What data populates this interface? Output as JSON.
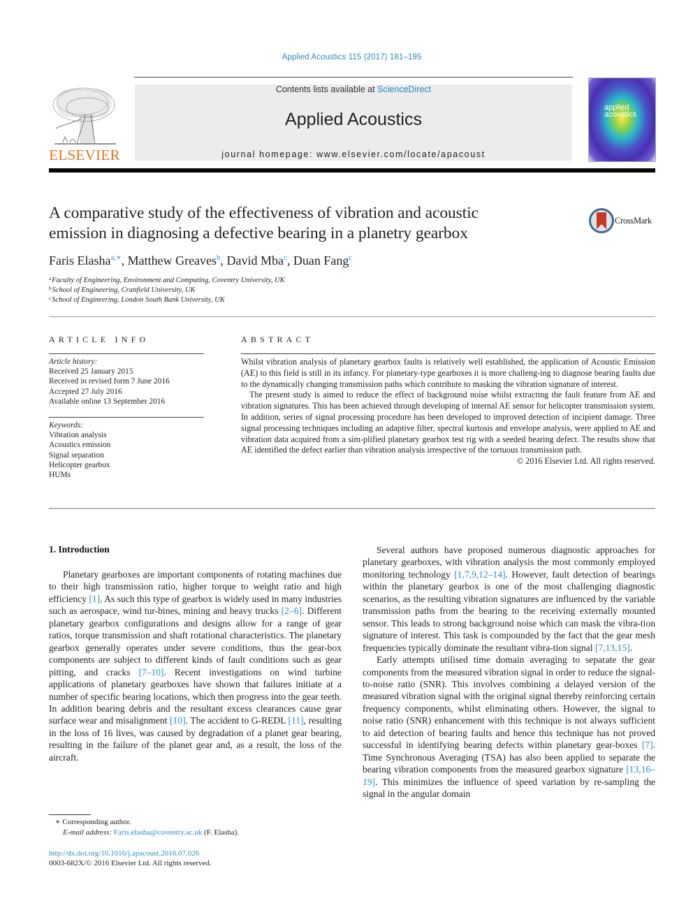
{
  "header": {
    "journal_ref": "Applied Acoustics 115 (2017) 181–195",
    "contents_prefix": "Contents lists available at ",
    "sciencedirect_link": "ScienceDirect",
    "journal_name": "Applied Acoustics",
    "homepage_prefix": "journal homepage: ",
    "homepage_url": "www.elsevier.com/locate/apacoust",
    "publisher_logo_text": "ELSEVIER",
    "cover_title_line1": "applied",
    "cover_title_line2": "acoustics",
    "colors": {
      "link": "#2a8bbf",
      "elsevier_orange": "#e9711c",
      "banner_bg": "#ececec"
    }
  },
  "article": {
    "title_line1": "A comparative study of the effectiveness of vibration and acoustic",
    "title_line2": "emission in diagnosing a defective bearing in a planetry gearbox",
    "crossmark_label": "CrossMark",
    "authors": [
      {
        "name": "Faris Elasha",
        "sup": "a,∗"
      },
      {
        "name": "Matthew Greaves",
        "sup": "b"
      },
      {
        "name": "David Mba",
        "sup": "c"
      },
      {
        "name": "Duan Fang",
        "sup": "c"
      }
    ],
    "affiliations": [
      {
        "key": "a",
        "text": "Faculty of Engineering, Environment and Computing, Coventry University, UK"
      },
      {
        "key": "b",
        "text": "School of Engineering, Cranfield University, UK"
      },
      {
        "key": "c",
        "text": "School of Engineering, London South Bank University, UK"
      }
    ]
  },
  "article_info": {
    "heading": "ARTICLE INFO",
    "history_label": "Article history:",
    "history": [
      "Received 25 January 2015",
      "Received in revised form 7 June 2016",
      "Accepted 27 July 2016",
      "Available online 13 September 2016"
    ],
    "keywords_label": "Keywords:",
    "keywords": [
      "Vibration analysis",
      "Acoustics emission",
      "Signal separation",
      "Helicopter gearbox",
      "HUMs"
    ]
  },
  "abstract": {
    "heading": "ABSTRACT",
    "paragraphs": [
      "Whilst vibration analysis of planetary gearbox faults is relatively well established, the application of Acoustic Emission (AE) to this field is still in its infancy. For planetary-type gearboxes it is more challeng-ing to diagnose bearing faults due to the dynamically changing transmission paths which contribute to masking the vibration signature of interest.",
      "The present study is aimed to reduce the effect of background noise whilst extracting the fault feature from AE and vibration signatures. This has been achieved through developing of internal AE sensor for helicopter transmission system. In addition, series of signal processing procedure has been developed to improved detection of incipient damage. Three signal processing techniques including an adaptive filter, spectral kurtosis and envelope analysis, were applied to AE and vibration data acquired from a sim-plified planetary gearbox test rig with a seeded bearing defect. The results show that AE identified the defect earlier than vibration analysis irrespective of the tortuous transmission path."
    ],
    "copyright": "© 2016 Elsevier Ltd. All rights reserved."
  },
  "body": {
    "section_heading": "1. Introduction",
    "left_paragraph": [
      {
        "t": "Planetary gearboxes are important components of rotating machines due to their high transmission ratio, higher torque to weight ratio and high efficiency "
      },
      {
        "ref": "[1]"
      },
      {
        "t": ". As such this type of gearbox is widely used in many industries such as aerospace, wind tur-bines, mining and heavy trucks "
      },
      {
        "ref": "[2–6]"
      },
      {
        "t": ". Different planetary gearbox configurations and designs allow for a range of gear ratios, torque transmission and shaft rotational characteristics. The planetary gearbox generally operates under severe conditions, thus the gear-box components are subject to different kinds of fault conditions such as gear pitting, and cracks "
      },
      {
        "ref": "[7–10]"
      },
      {
        "t": ". Recent investigations on wind turbine applications of planetary gearboxes have shown that failures initiate at a number of specific bearing locations, which then progress into the gear teeth. In addition bearing debris and the resultant excess clearances cause gear surface wear and misalignment "
      },
      {
        "ref": "[10]"
      },
      {
        "t": ". The accident to G-REDL "
      },
      {
        "ref": "[11]"
      },
      {
        "t": ", resulting in the loss of 16 lives, was caused by degradation of a planet gear bearing, resulting in the failure of the planet gear and, as a result, the loss of the aircraft."
      }
    ],
    "right_paragraph_1": [
      {
        "t": "Several authors have proposed numerous diagnostic approaches for planetary gearboxes, with vibration analysis the most commonly employed monitoring technology "
      },
      {
        "ref": "[1,7,9,12–14]"
      },
      {
        "t": ". However, fault detection of bearings within the planetary gearbox is one of the most challenging diagnostic scenarios, as the resulting vibration signatures are influenced by the variable transmission paths from the bearing to the receiving externally mounted sensor. This leads to strong background noise which can mask the vibra-tion signature of interest. This task is compounded by the fact that the gear mesh frequencies typically dominate the resultant vibra-tion signal "
      },
      {
        "ref": "[7,13,15]"
      },
      {
        "t": "."
      }
    ],
    "right_paragraph_2": [
      {
        "t": "Early attempts utilised time domain averaging to separate the gear components from the measured vibration signal in order to reduce the signal-to-noise ratio (SNR). This involves combining a delayed version of the measured vibration signal with the original signal thereby reinforcing certain frequency components, whilst eliminating others. However, the signal to noise ratio (SNR) enhancement with this technique is not always sufficient to aid detection of bearing faults and hence this technique has not proved successful in identifying bearing defects within planetary gear-boxes "
      },
      {
        "ref": "[7]"
      },
      {
        "t": ". Time Synchronous Averaging (TSA) has also been applied to separate the bearing vibration components from the measured gearbox signature "
      },
      {
        "ref": "[13,16–19]"
      },
      {
        "t": ". This minimizes the influence of speed variation by re-sampling the signal in the angular domain"
      }
    ]
  },
  "footnotes": {
    "corresponding_marker": "∗",
    "corresponding_label": "Corresponding author.",
    "email_label": "E-mail address:",
    "email": "Faris.elasha@coventry.ac.uk",
    "email_suffix": " (F. Elasha).",
    "doi": "http://dx.doi.org/10.1016/j.apacoust.2016.07.026",
    "issn_line": "0003-682X/© 2016 Elsevier Ltd. All rights reserved."
  }
}
